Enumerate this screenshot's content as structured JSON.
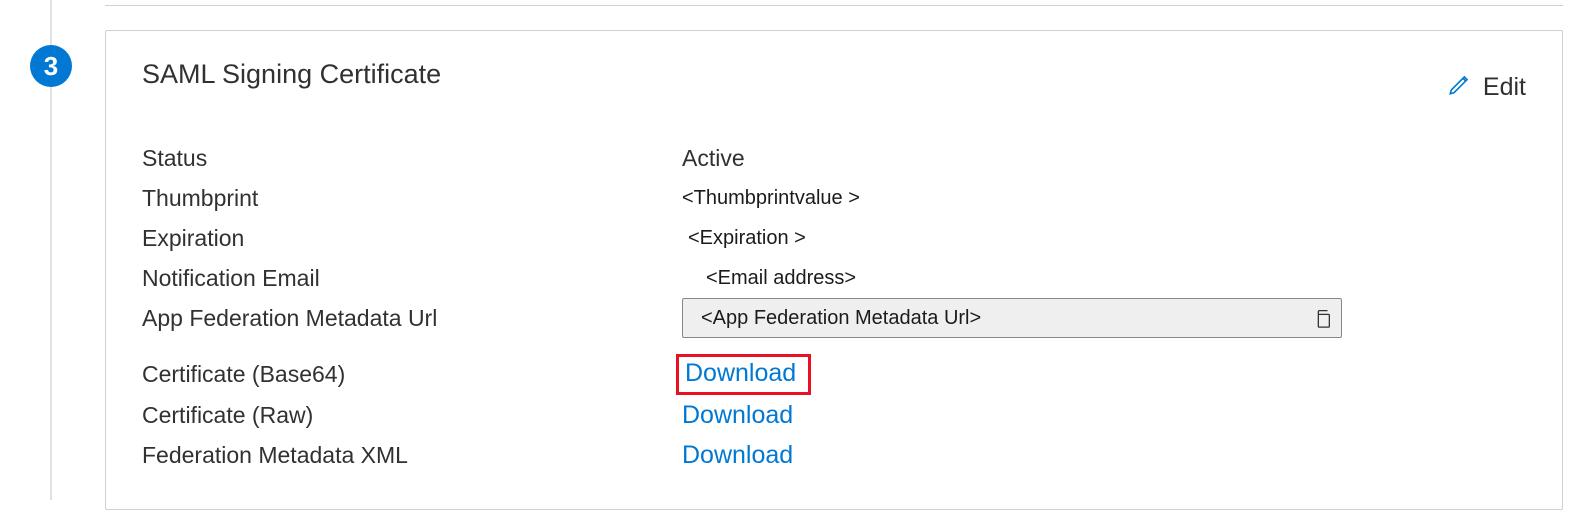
{
  "step_number": "3",
  "card": {
    "title": "SAML Signing Certificate",
    "edit_label": "Edit"
  },
  "fields": {
    "status": {
      "label": "Status",
      "value": "Active"
    },
    "thumbprint": {
      "label": "Thumbprint",
      "value": "<Thumbprintvalue >"
    },
    "expiration": {
      "label": "Expiration",
      "value": "<Expiration >"
    },
    "notification_email": {
      "label": "Notification Email",
      "value": "<Email address>"
    },
    "app_federation_url": {
      "label": "App Federation Metadata Url",
      "value": "<App Federation Metadata Url>"
    },
    "cert_base64": {
      "label": "Certificate (Base64)",
      "action": "Download"
    },
    "cert_raw": {
      "label": "Certificate (Raw)",
      "action": "Download"
    },
    "fed_metadata_xml": {
      "label": "Federation Metadata XML",
      "action": "Download"
    }
  }
}
